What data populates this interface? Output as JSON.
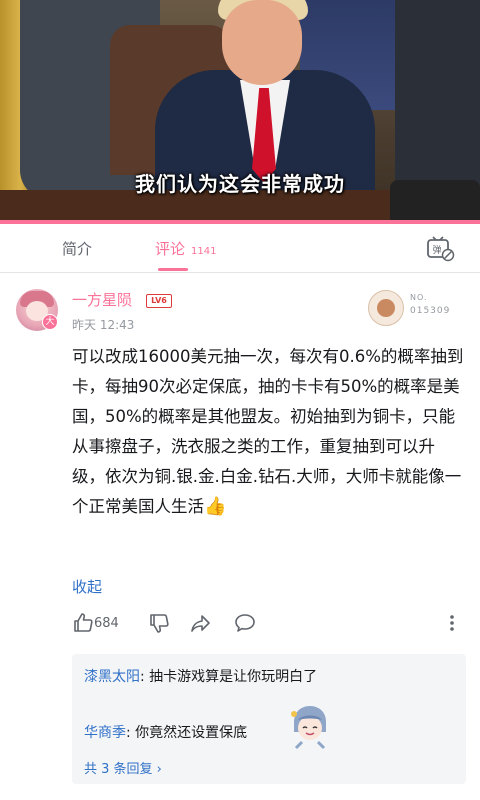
{
  "video": {
    "caption": "我们认为这会非常成功"
  },
  "tabs": {
    "intro": "简介",
    "comments": "评论",
    "comment_count": "1141"
  },
  "comment": {
    "username": "一方星陨",
    "level": "LV6",
    "time": "昨天 12:43",
    "avatar_badge": "大",
    "fan_badge_label": "NO.",
    "fan_badge_number": "015309",
    "text": "可以改成16000美元抽一次，每次有0.6%的概率抽到卡，每抽90次必定保底，抽的卡卡有50%的概率是美国，50%的概率是其他盟友。初始抽到为铜卡，只能从事擦盘子，洗衣服之类的工作，重复抽到可以升级，依次为铜.银.金.白金.钻石.大师，大师卡就能像一个正常美国人生活",
    "emoji": "👍",
    "collapse": "收起",
    "likes": "684"
  },
  "replies": {
    "items": [
      {
        "user": "漆黑太阳",
        "text": "抽卡游戏算是让你玩明白了"
      },
      {
        "user": "华商季",
        "text": "你竟然还设置保底"
      }
    ],
    "separator": ": ",
    "view_all": "共 3 条回复 ›"
  },
  "colors": {
    "accent": "#fb7299",
    "link": "#3071c8",
    "muted": "#9499a0"
  }
}
